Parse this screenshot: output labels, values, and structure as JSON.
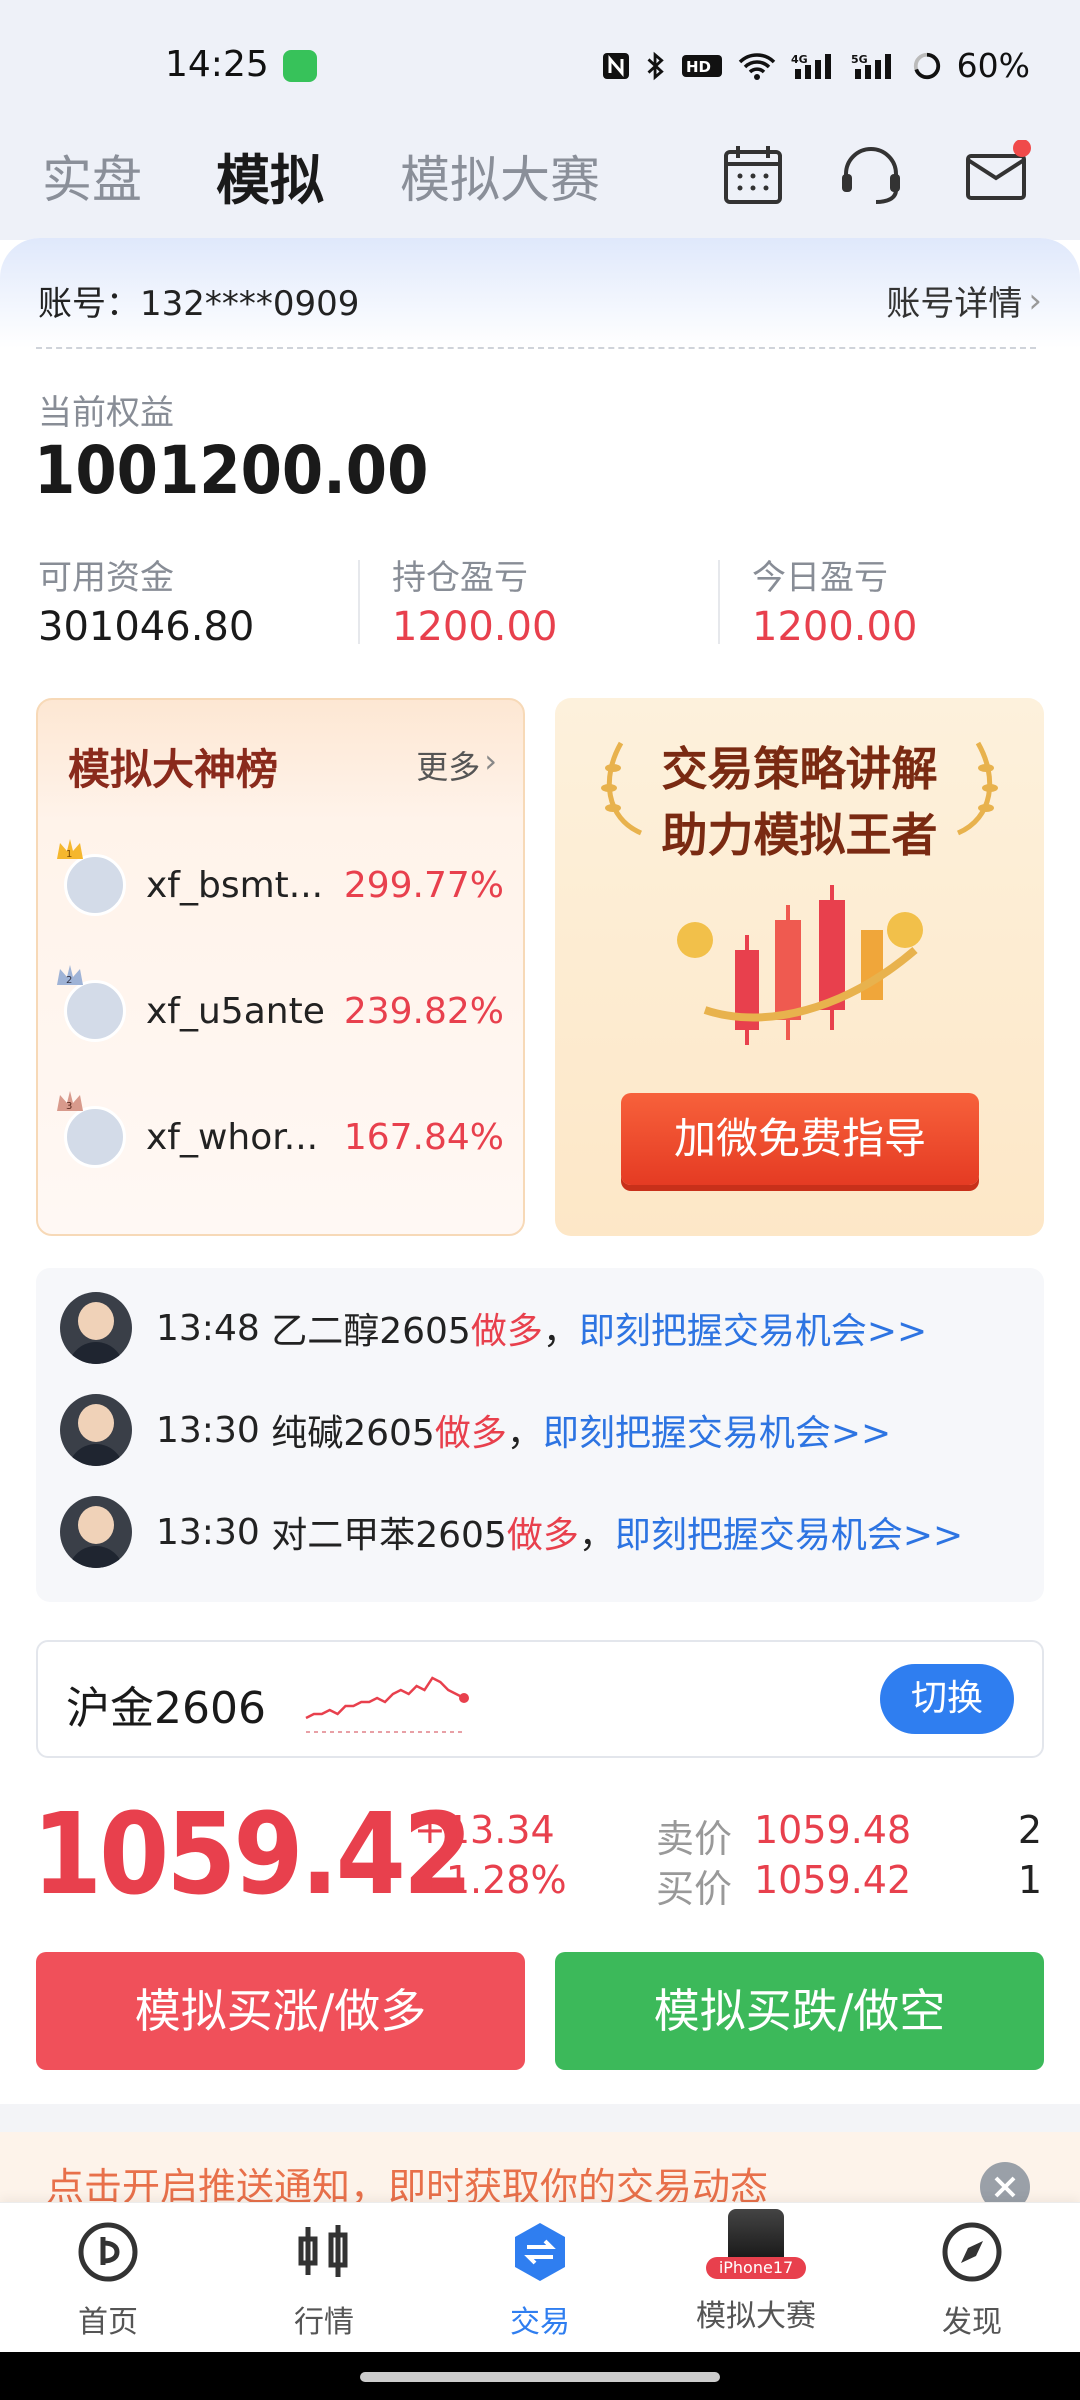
{
  "status_bar": {
    "time": "14:25",
    "battery": "60%",
    "network": "5G"
  },
  "header": {
    "tabs": [
      {
        "label": "实盘"
      },
      {
        "label": "模拟"
      },
      {
        "label": "模拟大赛"
      }
    ],
    "active_tab": 1
  },
  "account": {
    "label": "账号：132****0909",
    "detail_link": "账号详情",
    "equity_label": "当前权益",
    "equity_value": "1001200.00",
    "stats": [
      {
        "label": "可用资金",
        "value": "301046.80"
      },
      {
        "label": "持仓盈亏",
        "value": "1200.00"
      },
      {
        "label": "今日盈亏",
        "value": "1200.00"
      }
    ]
  },
  "leaderboard": {
    "title": "模拟大神榜",
    "more": "更多",
    "rows": [
      {
        "rank": "1",
        "name": "xf_bsmt...",
        "pct": "299.77%"
      },
      {
        "rank": "2",
        "name": "xf_u5ante",
        "pct": "239.82%"
      },
      {
        "rank": "3",
        "name": "xf_whor...",
        "pct": "167.84%"
      }
    ]
  },
  "promo": {
    "line1": "交易策略讲解",
    "line2": "助力模拟王者",
    "button": "加微免费指导"
  },
  "news": [
    {
      "time": "13:48",
      "product": "乙二醇2605",
      "action": "做多",
      "sep": "，",
      "link": "即刻把握交易机会>>"
    },
    {
      "time": "13:30",
      "product": "纯碱2605",
      "action": "做多",
      "sep": "，",
      "link": "即刻把握交易机会>>"
    },
    {
      "time": "13:30",
      "product": "对二甲苯2605",
      "action": "做多",
      "sep": "，",
      "link": "即刻把握交易机会>>"
    }
  ],
  "ticker": {
    "name": "沪金2606",
    "switch": "切换",
    "spark": [
      2,
      3,
      3,
      4,
      3,
      5,
      5,
      6,
      6,
      7,
      6,
      8,
      9,
      8,
      10,
      9,
      12,
      11,
      9,
      8,
      7
    ]
  },
  "quote": {
    "price": "1059.42",
    "change": "+13.34",
    "change_pct": "+1.28%",
    "ask_label": "卖价",
    "ask": "1059.48",
    "ask_vol": "2",
    "bid_label": "买价",
    "bid": "1059.42",
    "bid_vol": "1"
  },
  "actions": {
    "buy": "模拟买涨/做多",
    "sell": "模拟买跌/做空"
  },
  "push": {
    "text": "点击开启推送通知，即时获取你的交易动态"
  },
  "nav": [
    {
      "label": "首页"
    },
    {
      "label": "行情"
    },
    {
      "label": "交易"
    },
    {
      "label": "模拟大赛",
      "badge": "iPhone17"
    },
    {
      "label": "发现"
    }
  ],
  "colors": {
    "accent": "#2f7ef0",
    "up": "#e8404d",
    "down": "#3cb95a"
  }
}
